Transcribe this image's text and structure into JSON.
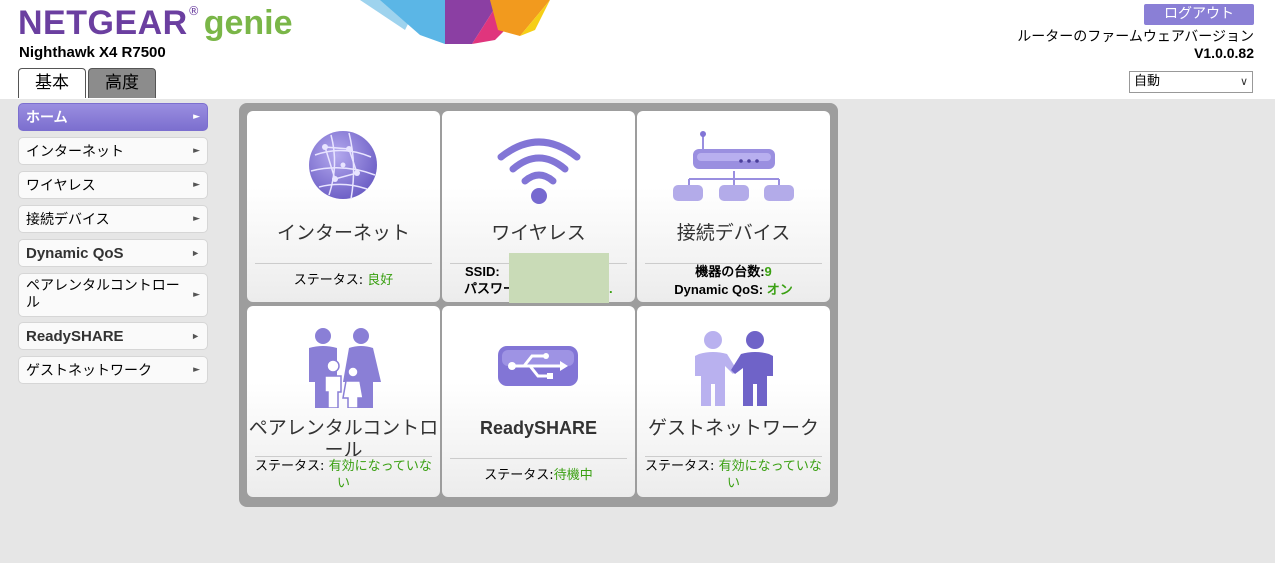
{
  "header": {
    "brand_name": "NETGEAR",
    "brand_reg": "®",
    "brand_product": "genie",
    "model": "Nighthawk X4 R7500",
    "logout_label": "ログアウト",
    "firmware_label": "ルーターのファームウェアバージョン",
    "firmware_version": "V1.0.0.82",
    "language_selected": "自動"
  },
  "tabs": [
    {
      "label": "基本",
      "active": true
    },
    {
      "label": "高度",
      "active": false
    }
  ],
  "sidebar": {
    "items": [
      {
        "label": "ホーム"
      },
      {
        "label": "インターネット"
      },
      {
        "label": "ワイヤレス"
      },
      {
        "label": "接続デバイス"
      },
      {
        "label": "Dynamic QoS"
      },
      {
        "label": "ペアレンタルコントロール"
      },
      {
        "label": "ReadySHARE"
      },
      {
        "label": "ゲストネットワーク"
      }
    ]
  },
  "tiles": {
    "internet": {
      "title": "インターネット",
      "status_label": "ステータス:",
      "status_value": "良好"
    },
    "wireless": {
      "title": "ワイヤレス",
      "ssid_label": "SSID:",
      "password_label": "パスワー",
      "password_tail": "."
    },
    "devices": {
      "title": "接続デバイス",
      "count_label": "機器の台数:",
      "count_value": "9",
      "qos_label": "Dynamic QoS:",
      "qos_value": "オン"
    },
    "parental": {
      "title": "ペアレンタルコントロール",
      "status_label": "ステータス:",
      "status_value": "有効になっていない"
    },
    "readyshare": {
      "title": "ReadySHARE",
      "status_label": "ステータス:",
      "status_value": "待機中"
    },
    "guest": {
      "title": "ゲストネットワーク",
      "status_label": "ステータス:",
      "status_value": "有効になっていない"
    }
  },
  "colors": {
    "brand_purple": "#6b3fa0",
    "brand_green": "#7ab648",
    "accent_purple": "#8a7fd6",
    "status_green": "#3aa012"
  },
  "icons": [
    "globe-icon",
    "wifi-icon",
    "router-network-icon",
    "family-icon",
    "usb-icon",
    "guest-handshake-icon",
    "chevron-right-icon",
    "chevron-down-icon"
  ]
}
